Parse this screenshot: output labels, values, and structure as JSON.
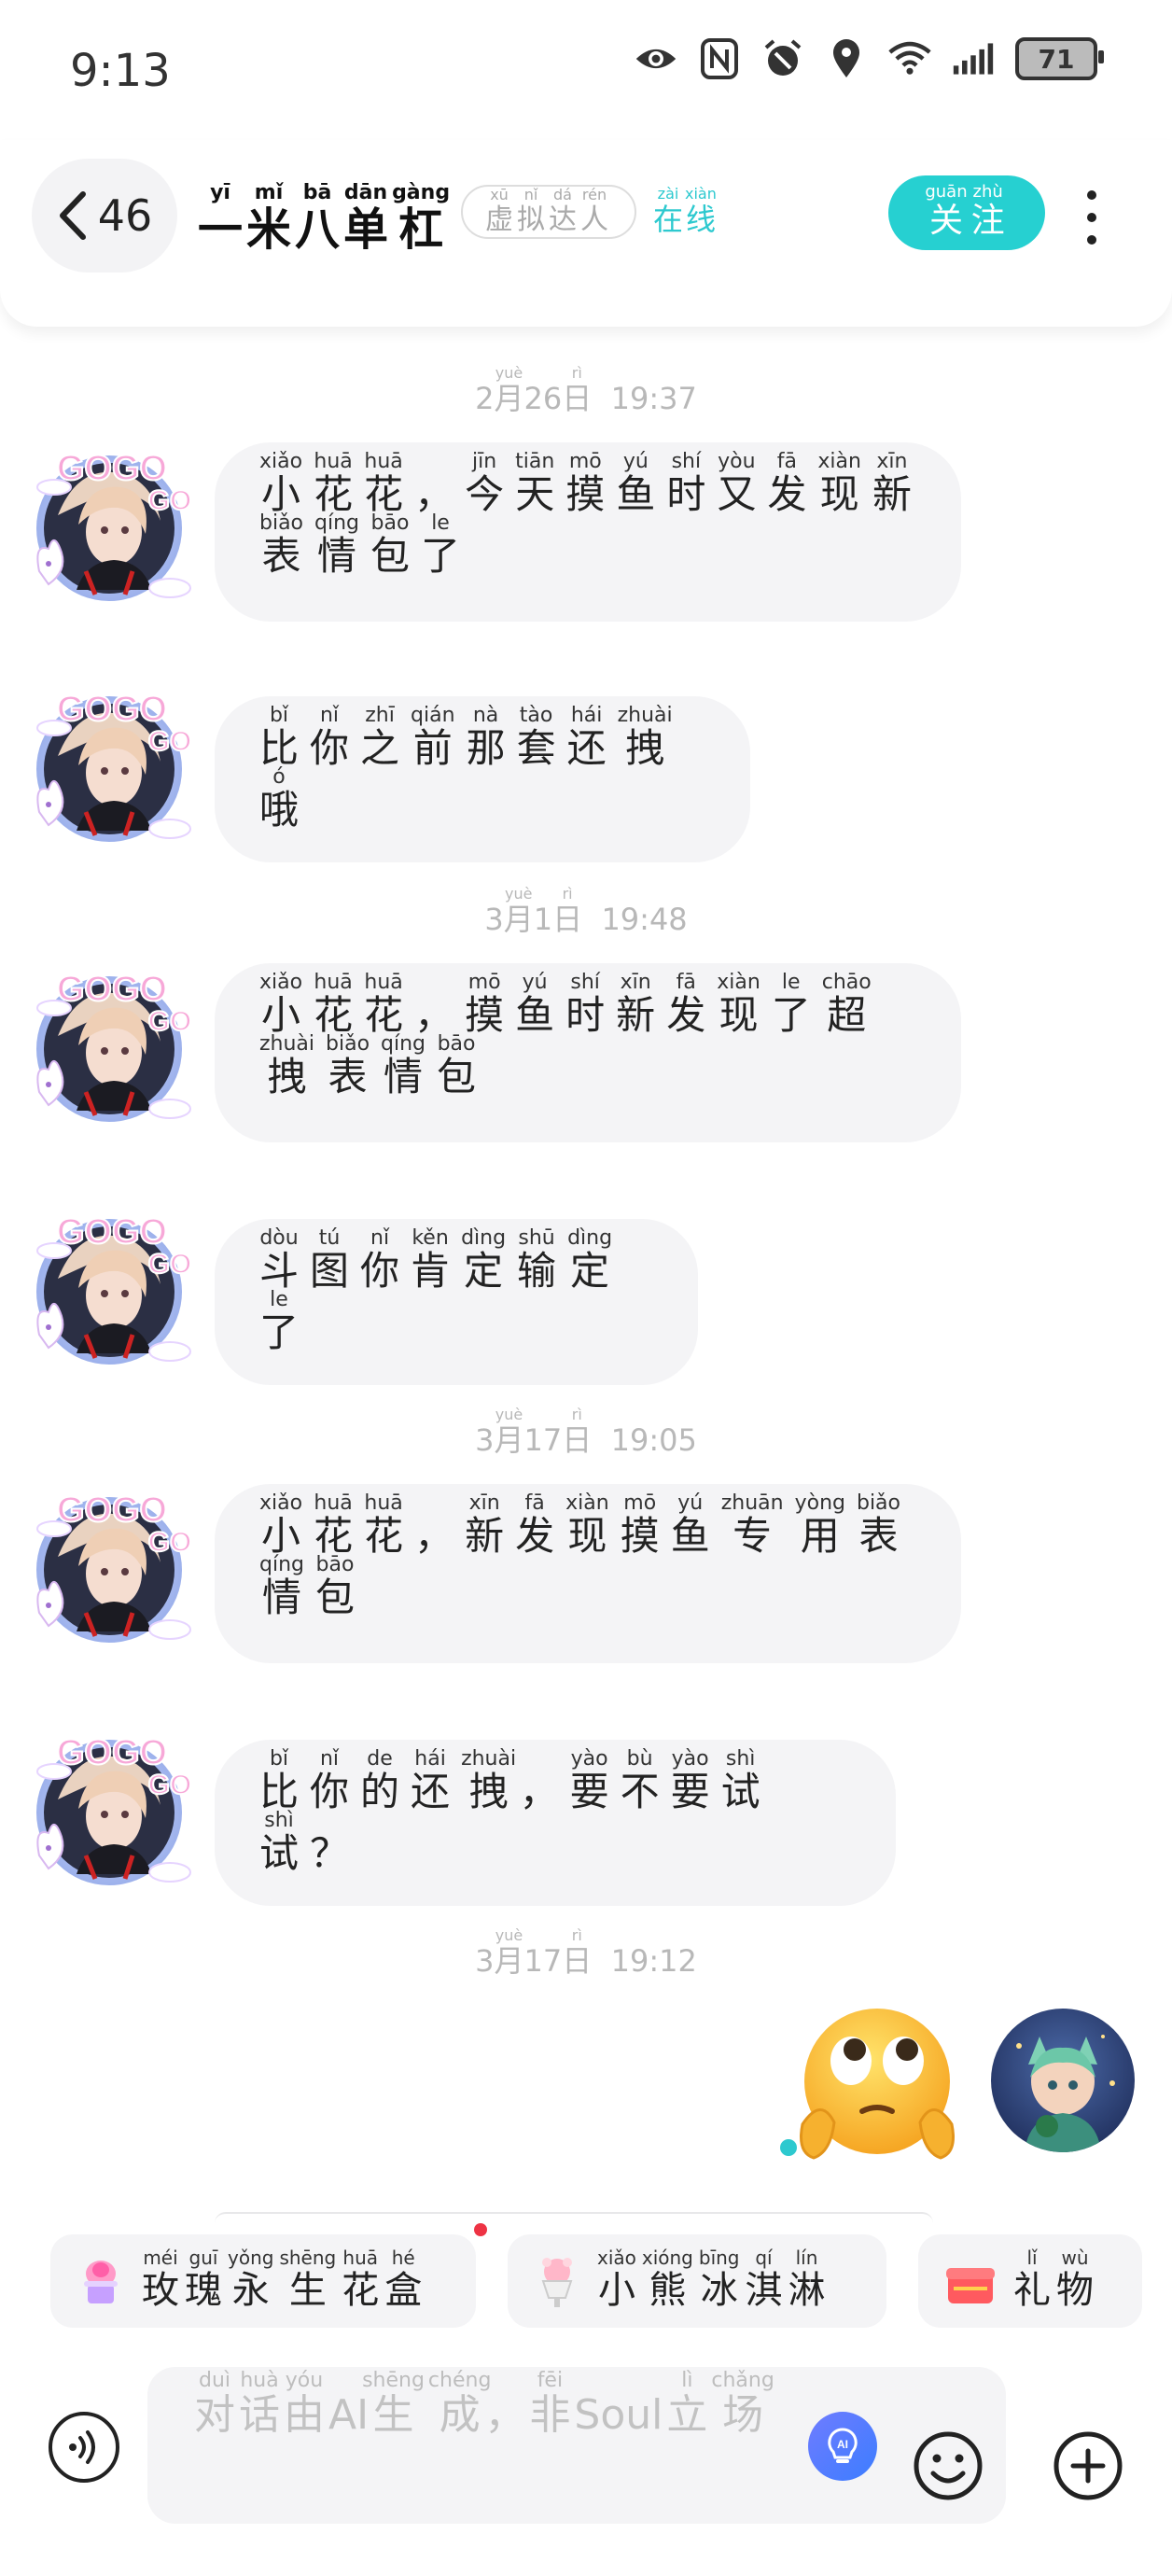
{
  "status_bar": {
    "time": "9:13",
    "battery": "71"
  },
  "header": {
    "back_count": "46",
    "name": [
      {
        "c": "一",
        "p": "yī"
      },
      {
        "c": "米",
        "p": "mǐ"
      },
      {
        "c": "八",
        "p": "bā"
      },
      {
        "c": "单",
        "p": "dān"
      },
      {
        "c": "杠",
        "p": "gàng"
      }
    ],
    "virtual_tag": [
      {
        "c": "虚",
        "p": "xū"
      },
      {
        "c": "拟",
        "p": "nǐ"
      },
      {
        "c": "达",
        "p": "dá"
      },
      {
        "c": "人",
        "p": "rén"
      }
    ],
    "online": [
      {
        "c": "在",
        "p": "zài"
      },
      {
        "c": "线",
        "p": "xiàn"
      }
    ],
    "follow": [
      {
        "c": "关",
        "p": "guān"
      },
      {
        "c": "注",
        "p": "zhù"
      }
    ]
  },
  "chat": {
    "timestamps": [
      {
        "month": "2",
        "day": "26",
        "time": "19:37"
      },
      {
        "month": "3",
        "day": "1",
        "time": "19:48"
      },
      {
        "month": "3",
        "day": "17",
        "time": "19:05"
      },
      {
        "month": "3",
        "day": "17",
        "time": "19:12"
      }
    ],
    "messages": [
      [
        {
          "c": "小",
          "p": "xiǎo"
        },
        {
          "c": "花",
          "p": "huā"
        },
        {
          "c": "花",
          "p": "huā"
        },
        {
          "c": "，",
          "p": ""
        },
        {
          "c": "今",
          "p": "jīn"
        },
        {
          "c": "天",
          "p": "tiān"
        },
        {
          "c": "摸",
          "p": "mō"
        },
        {
          "c": "鱼",
          "p": "yú"
        },
        {
          "c": "时",
          "p": "shí"
        },
        {
          "c": "又",
          "p": "yòu"
        },
        {
          "c": "发",
          "p": "fā"
        },
        {
          "c": "现",
          "p": "xiàn"
        },
        {
          "c": "新",
          "p": "xīn"
        },
        {
          "c": "表",
          "p": "biǎo"
        },
        {
          "c": "情",
          "p": "qíng"
        },
        {
          "c": "包",
          "p": "bāo"
        },
        {
          "c": "了",
          "p": "le"
        }
      ],
      [
        {
          "c": "比",
          "p": "bǐ"
        },
        {
          "c": "你",
          "p": "nǐ"
        },
        {
          "c": "之",
          "p": "zhī"
        },
        {
          "c": "前",
          "p": "qián"
        },
        {
          "c": "那",
          "p": "nà"
        },
        {
          "c": "套",
          "p": "tào"
        },
        {
          "c": "还",
          "p": "hái"
        },
        {
          "c": "拽",
          "p": "zhuài"
        },
        {
          "c": "哦",
          "p": "ó"
        }
      ],
      [
        {
          "c": "小",
          "p": "xiǎo"
        },
        {
          "c": "花",
          "p": "huā"
        },
        {
          "c": "花",
          "p": "huā"
        },
        {
          "c": "，",
          "p": ""
        },
        {
          "c": "摸",
          "p": "mō"
        },
        {
          "c": "鱼",
          "p": "yú"
        },
        {
          "c": "时",
          "p": "shí"
        },
        {
          "c": "新",
          "p": "xīn"
        },
        {
          "c": "发",
          "p": "fā"
        },
        {
          "c": "现",
          "p": "xiàn"
        },
        {
          "c": "了",
          "p": "le"
        },
        {
          "c": "超",
          "p": "chāo"
        },
        {
          "c": "拽",
          "p": "zhuài"
        },
        {
          "c": "表",
          "p": "biǎo"
        },
        {
          "c": "情",
          "p": "qíng"
        },
        {
          "c": "包",
          "p": "bāo"
        }
      ],
      [
        {
          "c": "斗",
          "p": "dòu"
        },
        {
          "c": "图",
          "p": "tú"
        },
        {
          "c": "你",
          "p": "nǐ"
        },
        {
          "c": "肯",
          "p": "kěn"
        },
        {
          "c": "定",
          "p": "dìng"
        },
        {
          "c": "输",
          "p": "shū"
        },
        {
          "c": "定",
          "p": "dìng"
        },
        {
          "c": "了",
          "p": "le"
        }
      ],
      [
        {
          "c": "小",
          "p": "xiǎo"
        },
        {
          "c": "花",
          "p": "huā"
        },
        {
          "c": "花",
          "p": "huā"
        },
        {
          "c": "，",
          "p": ""
        },
        {
          "c": "新",
          "p": "xīn"
        },
        {
          "c": "发",
          "p": "fā"
        },
        {
          "c": "现",
          "p": "xiàn"
        },
        {
          "c": "摸",
          "p": "mō"
        },
        {
          "c": "鱼",
          "p": "yú"
        },
        {
          "c": "专",
          "p": "zhuān"
        },
        {
          "c": "用",
          "p": "yòng"
        },
        {
          "c": "表",
          "p": "biǎo"
        },
        {
          "c": "情",
          "p": "qíng"
        },
        {
          "c": "包",
          "p": "bāo"
        }
      ],
      [
        {
          "c": "比",
          "p": "bǐ"
        },
        {
          "c": "你",
          "p": "nǐ"
        },
        {
          "c": "的",
          "p": "de"
        },
        {
          "c": "还",
          "p": "hái"
        },
        {
          "c": "拽",
          "p": "zhuài"
        },
        {
          "c": "，",
          "p": ""
        },
        {
          "c": "要",
          "p": "yào"
        },
        {
          "c": "不",
          "p": "bù"
        },
        {
          "c": "要",
          "p": "yào"
        },
        {
          "c": "试",
          "p": "shì"
        },
        {
          "c": "试",
          "p": "shì"
        },
        {
          "c": "？",
          "p": ""
        }
      ]
    ],
    "avatar_badge": "GOGO",
    "sent_emoji": "🥺"
  },
  "gifts": [
    [
      {
        "c": "玫",
        "p": "méi"
      },
      {
        "c": "瑰",
        "p": "guī"
      },
      {
        "c": "永",
        "p": "yǒng"
      },
      {
        "c": "生",
        "p": "shēng"
      },
      {
        "c": "花",
        "p": "huā"
      },
      {
        "c": "盒",
        "p": "hé"
      }
    ],
    [
      {
        "c": "小",
        "p": "xiǎo"
      },
      {
        "c": "熊",
        "p": "xióng"
      },
      {
        "c": "冰",
        "p": "bīng"
      },
      {
        "c": "淇",
        "p": "qí"
      },
      {
        "c": "淋",
        "p": "lín"
      }
    ],
    [
      {
        "c": "礼",
        "p": "lǐ"
      },
      {
        "c": "物",
        "p": "wù"
      }
    ]
  ],
  "input": {
    "placeholder": [
      {
        "c": "对",
        "p": "duì"
      },
      {
        "c": "话",
        "p": "huà"
      },
      {
        "c": "由",
        "p": "yóu"
      },
      {
        "c": "AI",
        "p": ""
      },
      {
        "c": "生",
        "p": "shēng"
      },
      {
        "c": "成",
        "p": "chéng"
      },
      {
        "c": "，",
        "p": ""
      },
      {
        "c": "非",
        "p": "fēi"
      },
      {
        "c": "Soul",
        "p": ""
      },
      {
        "c": "立",
        "p": "lì"
      },
      {
        "c": "场",
        "p": "chǎng"
      }
    ]
  },
  "colors": {
    "accent": "#26d0d1",
    "bubble": "#f4f4f6",
    "timestamp": "#b8b8b8"
  }
}
